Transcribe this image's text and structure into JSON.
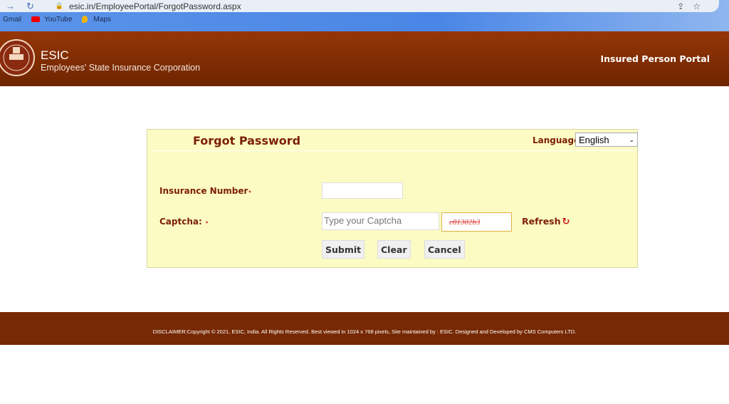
{
  "browser": {
    "url": "esic.in/EmployeePortal/ForgotPassword.aspx",
    "bookmarks": [
      "Gmail",
      "YouTube",
      "Maps"
    ]
  },
  "header": {
    "org_short": "ESIC",
    "org_full": "Employees' State Insurance Corporation",
    "portal": "Insured Person Portal"
  },
  "form": {
    "title": "Forgot Password",
    "language_label": "Language:",
    "language_value": "English",
    "insurance_label": "Insurance Number",
    "insurance_value": "",
    "captcha_label": "Captcha:",
    "captcha_placeholder": "Type your Captcha",
    "captcha_code": "c81302b3",
    "refresh_label": "Refresh",
    "submit": "Submit",
    "clear": "Clear",
    "cancel": "Cancel"
  },
  "footer": {
    "text": "DISCLAIMER:Copyright © 2021, ESIC, India. All Rights Reserved. Best viewed in 1024 x 768 pixels, Site maintained by : ESIC. Designed and Developed by CMS Computers LTD."
  },
  "colors": {
    "header": "#7c2a03",
    "panel": "#fcfbc4",
    "label": "#7c1f06"
  }
}
